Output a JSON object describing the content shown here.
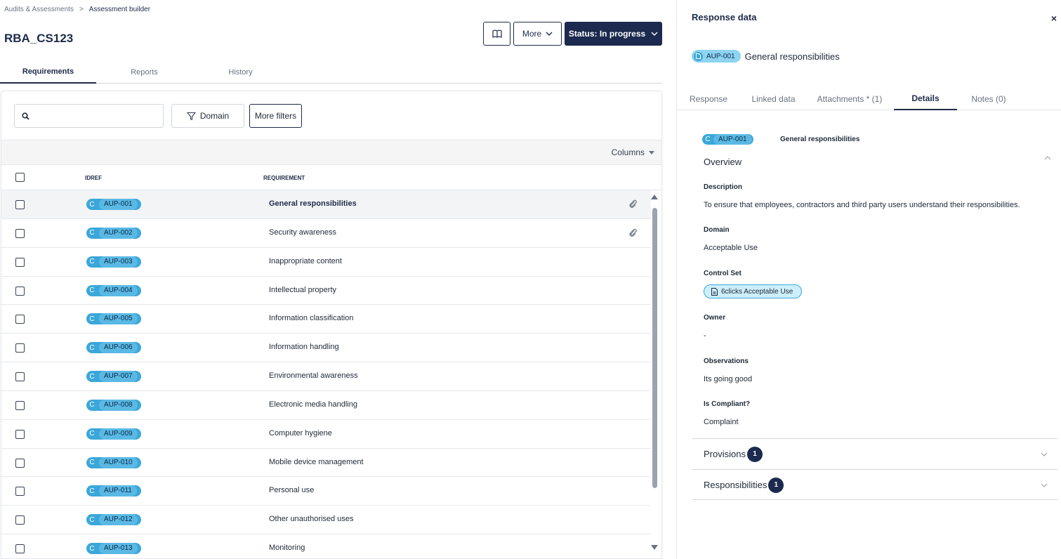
{
  "breadcrumb": {
    "parent": "Audits & Assessments",
    "separator": ">",
    "current": "Assessment builder"
  },
  "page": {
    "title": "RBA_CS123"
  },
  "header_buttons": {
    "more_label": "More",
    "status_label": "Status: In progress"
  },
  "tabs": [
    {
      "label": "Requirements",
      "active": true
    },
    {
      "label": "Reports",
      "active": false
    },
    {
      "label": "History",
      "active": false
    }
  ],
  "filters": {
    "search_placeholder": "",
    "domain_label": "Domain",
    "more_filters_label": "More filters"
  },
  "table": {
    "columns_label": "Columns",
    "headers": {
      "idref": "IDREF",
      "requirement": "REQUIREMENT"
    },
    "rows": [
      {
        "badge": "C",
        "id": "AUP-001",
        "requirement": "General responsibilities",
        "attachment": true,
        "selected": true
      },
      {
        "badge": "C",
        "id": "AUP-002",
        "requirement": "Security awareness",
        "attachment": true,
        "selected": false
      },
      {
        "badge": "C",
        "id": "AUP-003",
        "requirement": "Inappropriate content",
        "attachment": false,
        "selected": false
      },
      {
        "badge": "C",
        "id": "AUP-004",
        "requirement": "Intellectual property",
        "attachment": false,
        "selected": false
      },
      {
        "badge": "C",
        "id": "AUP-005",
        "requirement": "Information classification",
        "attachment": false,
        "selected": false
      },
      {
        "badge": "C",
        "id": "AUP-006",
        "requirement": "Information handling",
        "attachment": false,
        "selected": false
      },
      {
        "badge": "C",
        "id": "AUP-007",
        "requirement": "Environmental awareness",
        "attachment": false,
        "selected": false
      },
      {
        "badge": "C",
        "id": "AUP-008",
        "requirement": "Electronic media handling",
        "attachment": false,
        "selected": false
      },
      {
        "badge": "C",
        "id": "AUP-009",
        "requirement": "Computer hygiene",
        "attachment": false,
        "selected": false
      },
      {
        "badge": "C",
        "id": "AUP-010",
        "requirement": "Mobile device management",
        "attachment": false,
        "selected": false
      },
      {
        "badge": "C",
        "id": "AUP-011",
        "requirement": "Personal use",
        "attachment": false,
        "selected": false
      },
      {
        "badge": "C",
        "id": "AUP-012",
        "requirement": "Other unauthorised uses",
        "attachment": false,
        "selected": false
      },
      {
        "badge": "C",
        "id": "AUP-013",
        "requirement": "Monitoring",
        "attachment": false,
        "selected": false
      }
    ]
  },
  "panel": {
    "title": "Response data",
    "close": "×",
    "header_id": "AUP-001",
    "header_name": "General responsibilities",
    "tabs": [
      {
        "label": "Response",
        "active": false
      },
      {
        "label": "Linked data",
        "active": false
      },
      {
        "label": "Attachments * (1)",
        "active": false
      },
      {
        "label": "Details",
        "active": true
      },
      {
        "label": "Notes (0)",
        "active": false
      }
    ],
    "details": {
      "badge": "C",
      "id": "AUP-001",
      "name": "General responsibilities",
      "overview_title": "Overview",
      "description_label": "Description",
      "description": "To ensure that employees, contractors and third party users understand their responsibilities.",
      "domain_label": "Domain",
      "domain": "Acceptable Use",
      "control_set_label": "Control Set",
      "control_set": "6clicks Acceptable Use",
      "owner_label": "Owner",
      "owner": "-",
      "observations_label": "Observations",
      "observations": "Its going good",
      "compliant_label": "Is Compliant?",
      "compliant": "Complaint"
    },
    "provisions": {
      "label": "Provisions",
      "count": "1"
    },
    "responsibilities": {
      "label": "Responsibilities",
      "count": "1"
    }
  },
  "colors": {
    "navy": "#1b2a4e",
    "badge_blue": "#3ba7d9",
    "badge_light": "#5ab9e4"
  }
}
